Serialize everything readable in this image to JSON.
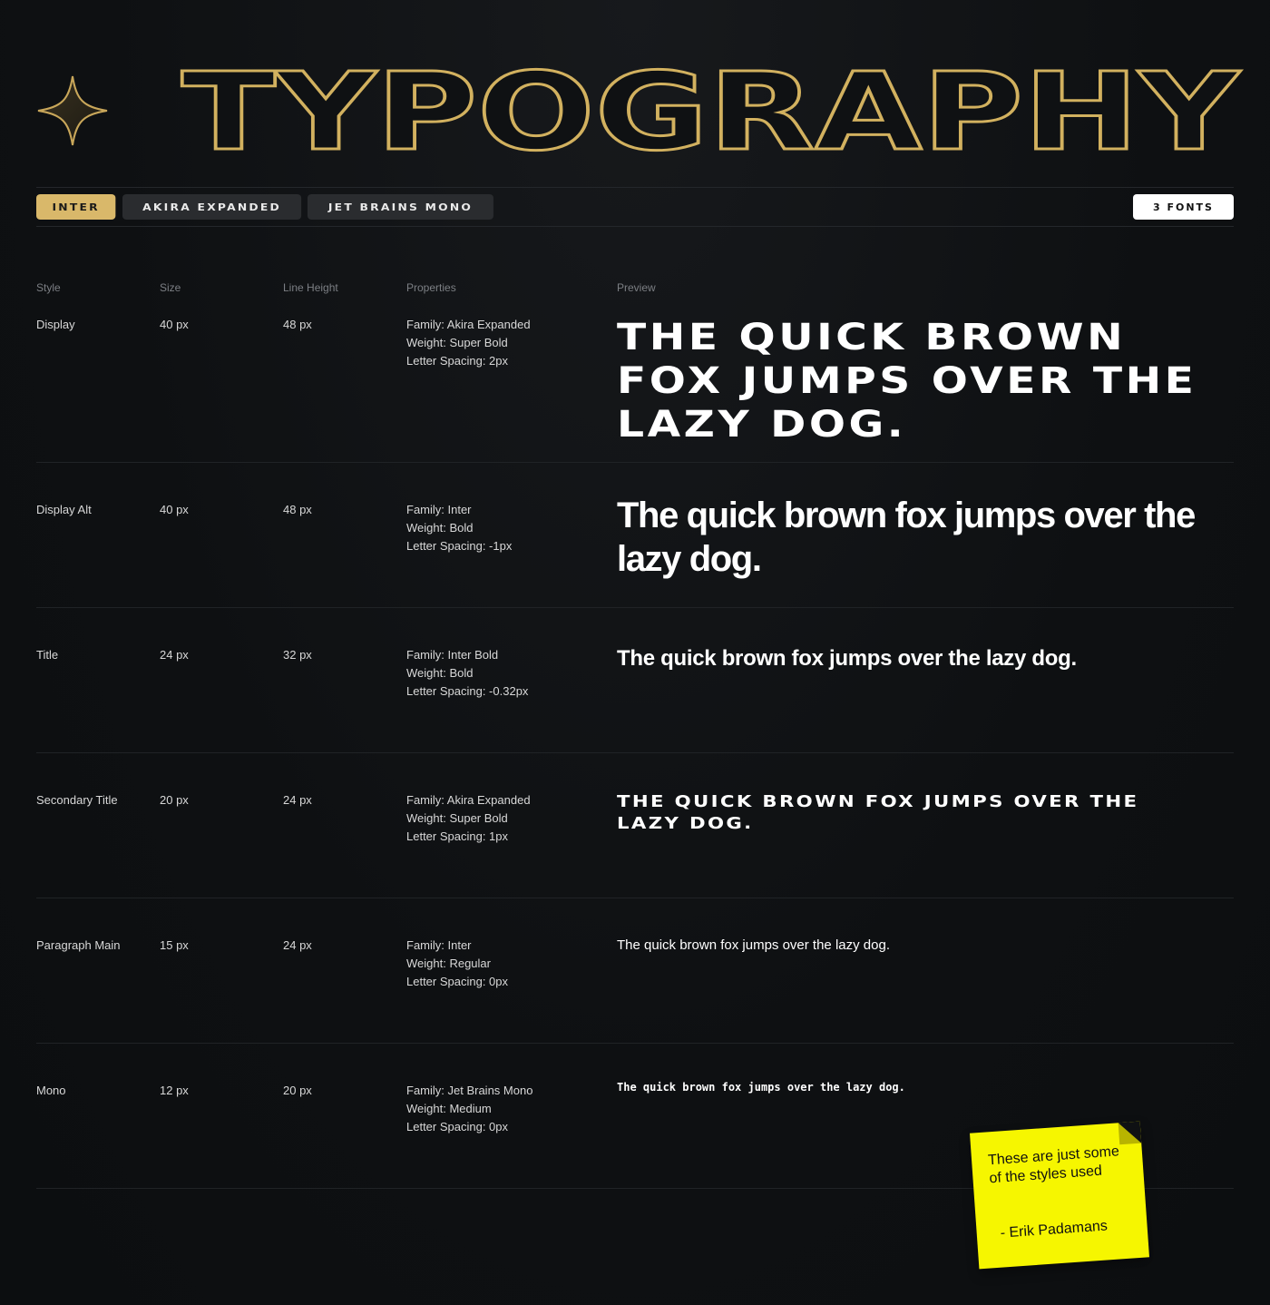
{
  "hero": {
    "title": "TYPOGRAPHY"
  },
  "tabs": [
    {
      "label": "INTER",
      "active": true
    },
    {
      "label": "AKIRA EXPANDED",
      "active": false
    },
    {
      "label": "JET BRAINS MONO",
      "active": false
    }
  ],
  "font_count": "3 FONTS",
  "columns": {
    "style": "Style",
    "size": "Size",
    "line_height": "Line Height",
    "properties": "Properties",
    "preview": "Preview"
  },
  "rows": [
    {
      "style": "Display",
      "size": "40 px",
      "line_height": "48 px",
      "family": "Family: Akira Expanded",
      "weight": "Weight: Super Bold",
      "spacing": "Letter Spacing: 2px",
      "preview": "The quick brown fox jumps over the lazy dog."
    },
    {
      "style": "Display Alt",
      "size": "40 px",
      "line_height": "48 px",
      "family": "Family: Inter",
      "weight": "Weight: Bold",
      "spacing": "Letter Spacing: -1px",
      "preview": "The quick brown fox jumps over the lazy dog."
    },
    {
      "style": "Title",
      "size": "24 px",
      "line_height": "32 px",
      "family": "Family: Inter Bold",
      "weight": "Weight: Bold",
      "spacing": "Letter Spacing: -0.32px",
      "preview": "The quick brown fox jumps over the lazy dog."
    },
    {
      "style": "Secondary Title",
      "size": "20 px",
      "line_height": "24 px",
      "family": "Family: Akira Expanded",
      "weight": "Weight: Super Bold",
      "spacing": "Letter Spacing: 1px",
      "preview": "The quick brown fox jumps over the lazy dog."
    },
    {
      "style": "Paragraph Main",
      "size": "15 px",
      "line_height": "24 px",
      "family": "Family: Inter",
      "weight": "Weight: Regular",
      "spacing": "Letter Spacing: 0px",
      "preview": "The quick brown fox jumps over the lazy dog."
    },
    {
      "style": "Mono",
      "size": "12 px",
      "line_height": "20 px",
      "family": "Family: Jet Brains Mono",
      "weight": "Weight: Medium",
      "spacing": "Letter Spacing: 0px",
      "preview": "The quick brown fox jumps over the lazy dog."
    }
  ],
  "sticky_note": {
    "text": "These are just some of the styles used",
    "signature": "- Erik Padamans"
  },
  "colors": {
    "accent": "#d9b86a",
    "background": "#0f1113",
    "sticky": "#f6f600"
  },
  "icons": {
    "logo": "four-point-star-icon"
  }
}
